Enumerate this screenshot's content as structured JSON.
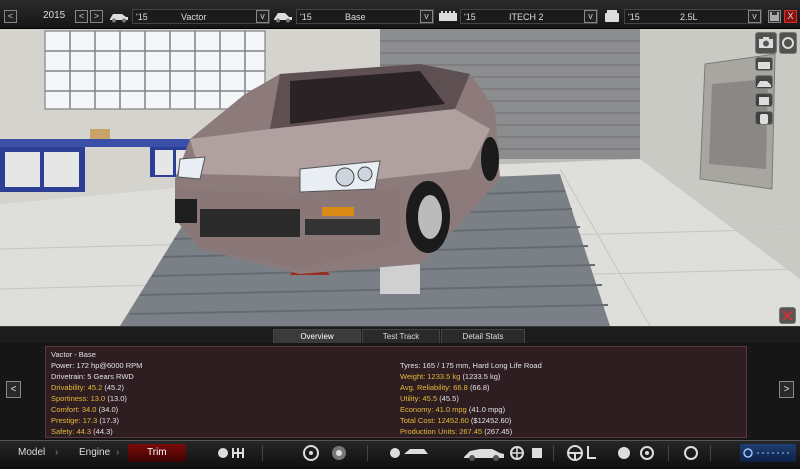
{
  "toolbar": {
    "year": "2015",
    "prev_label": "<",
    "next_label": ">",
    "model": {
      "year": "'15",
      "name": "Vactor"
    },
    "trim": {
      "year": "'15",
      "name": "Base"
    },
    "engine": {
      "year": "'15",
      "name": "ITECH 2"
    },
    "variant": {
      "year": "'15",
      "name": "2.5L"
    },
    "dropdown_glyph": "v",
    "close_label": "X",
    "accent": "#b01414"
  },
  "tabs": [
    {
      "label": "Overview",
      "active": true
    },
    {
      "label": "Test Track",
      "active": false
    },
    {
      "label": "Detail Stats",
      "active": false
    }
  ],
  "stats": {
    "left": [
      {
        "label": "Vactor - Base",
        "value": "",
        "highlight": false
      },
      {
        "label": "Power:",
        "value": "172 hp@6000 RPM",
        "highlight": false
      },
      {
        "label": "Drivetrain:",
        "value": "5 Gears RWD",
        "highlight": false
      },
      {
        "label": "Drivability:",
        "value": "45.2",
        "extra": "(45.2)",
        "highlight": true
      },
      {
        "label": "Sportiness:",
        "value": "13.0",
        "extra": "(13.0)",
        "highlight": true
      },
      {
        "label": "Comfort:",
        "value": "34.0",
        "extra": "(34.0)",
        "highlight": true
      },
      {
        "label": "Prestige:",
        "value": "17.3",
        "extra": "(17.3)",
        "highlight": true
      },
      {
        "label": "Safety:",
        "value": "44.3",
        "extra": "(44.3)",
        "highlight": true
      }
    ],
    "right": [
      {
        "label": "Tyres:",
        "value": "165 / 175 mm, Hard Long Life Road",
        "highlight": false
      },
      {
        "label": "Weight:",
        "value": "1233.5 kg",
        "extra": "(1233.5 kg)",
        "highlight": true
      },
      {
        "label": "Avg. Reliability:",
        "value": "66.8",
        "extra": "(66.8)",
        "highlight": true
      },
      {
        "label": "Utility:",
        "value": "45.5",
        "extra": "(45.5)",
        "highlight": true
      },
      {
        "label": "Economy:",
        "value": "41.0 mpg",
        "extra": "(41.0 mpg)",
        "highlight": true
      },
      {
        "label": "Total Cost:",
        "value": "12452.60",
        "extra": "($12452.60)",
        "highlight": true
      },
      {
        "label": "Production Units:",
        "value": "267.45",
        "extra": "(267.45)",
        "highlight": true
      }
    ]
  },
  "nav": {
    "prev": "<",
    "next": ">"
  },
  "bottombar": {
    "model": "Model",
    "engine": "Engine",
    "trim": "Trim"
  }
}
